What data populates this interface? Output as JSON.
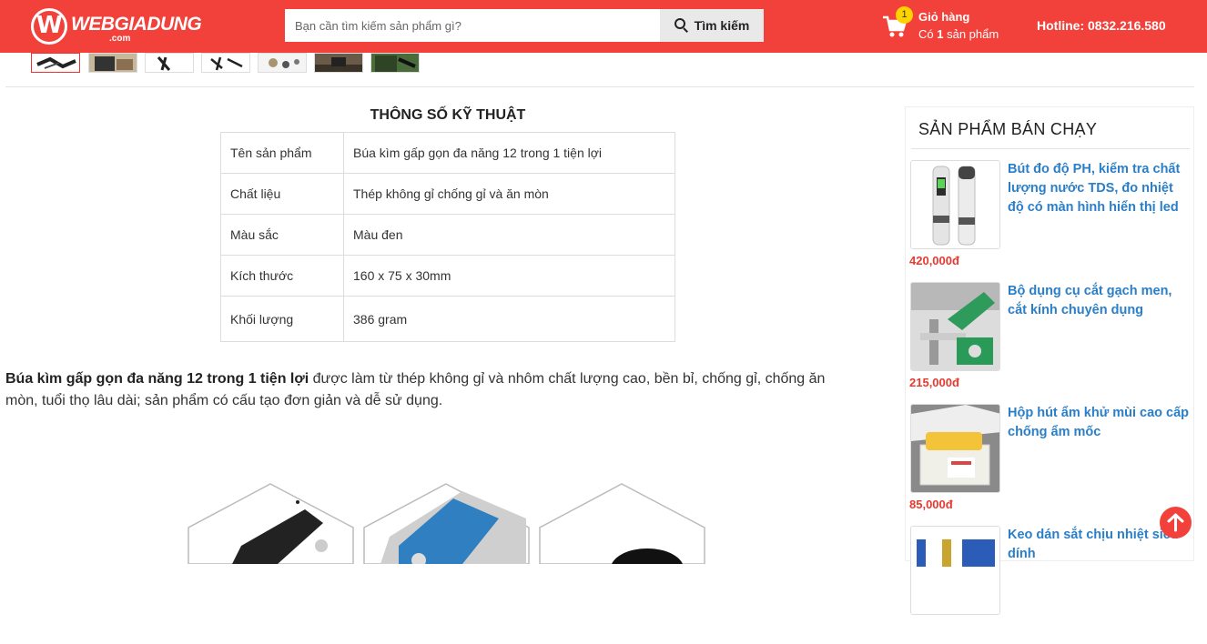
{
  "header": {
    "logo_text": "WEBGIADUNG",
    "logo_sub": ".com",
    "search_placeholder": "Bạn cần tìm kiếm sản phẩm gì?",
    "search_button": "Tìm kiếm",
    "cart_badge": "1",
    "cart_title": "Giỏ hàng",
    "cart_count_prefix": "Có",
    "cart_count_num": "1",
    "cart_count_suffix": "sản phẩm",
    "hotline": "Hotline: 0832.216.580",
    "accent_color": "#f2413a"
  },
  "specs": {
    "title": "THÔNG SỐ KỸ THUẬT",
    "rows": [
      {
        "key": "Tên sản phẩm",
        "value": "Búa kìm gấp gọn đa năng 12 trong 1 tiện lợi"
      },
      {
        "key": "Chất liệu",
        "value": "Thép không gỉ chống gỉ và ăn mòn"
      },
      {
        "key": "Màu sắc",
        "value": "Màu đen"
      },
      {
        "key": "Kích thước",
        "value": "160 x 75 x 30mm"
      },
      {
        "key": "Khối lượng",
        "value": "386 gram"
      }
    ]
  },
  "description": {
    "bold": "Búa kìm gấp gọn đa năng 12 trong 1 tiện lợi",
    "rest": " được làm từ thép không gỉ và nhôm chất lượng cao, bền bỉ, chống gỉ, chống ăn mòn, tuổi thọ lâu dài; sản phẩm có cấu tạo đơn giản và dễ sử dụng."
  },
  "sidebar": {
    "title": "SẢN PHẨM BÁN CHẠY",
    "items": [
      {
        "name": "Bút đo độ PH, kiểm tra chất lượng nước TDS, đo nhiệt độ có màn hình hiển thị led",
        "price": "420,000đ"
      },
      {
        "name": "Bộ dụng cụ cắt gạch men, cắt kính chuyên dụng",
        "price": "215,000đ"
      },
      {
        "name": "Hộp hút ẩm khử mùi cao cấp chống ẩm mốc",
        "price": "85,000đ"
      },
      {
        "name": "Keo dán sắt chịu nhiệt siêu dính",
        "price": ""
      }
    ]
  },
  "icons": {
    "search": "search-icon",
    "cart": "cart-icon",
    "scroll_top": "arrow-up-icon"
  }
}
